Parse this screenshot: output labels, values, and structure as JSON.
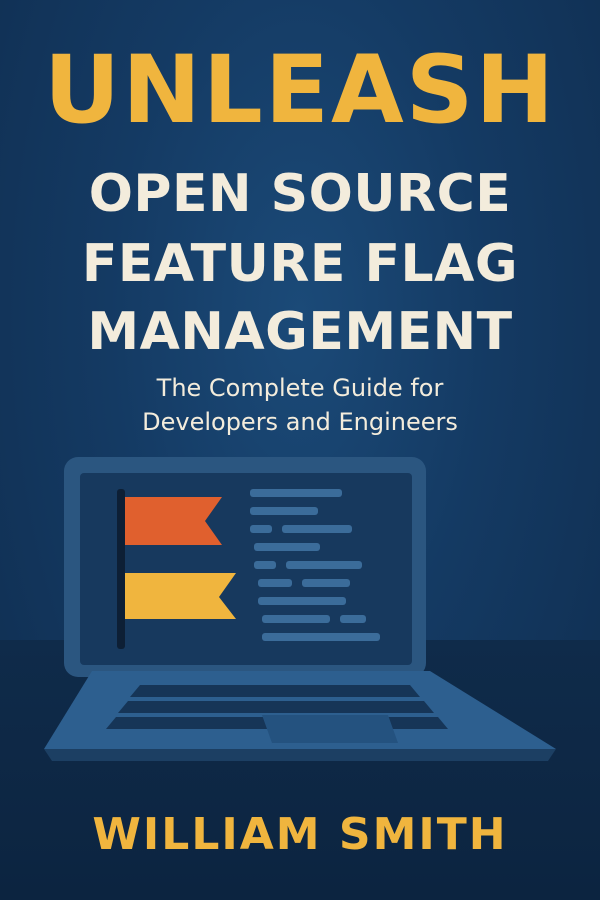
{
  "cover": {
    "title_main": "UNLEASH",
    "title_lines": [
      "OPEN SOURCE",
      "FEATURE FLAG",
      "MANAGEMENT"
    ],
    "subtitle_lines": [
      "The Complete Guide for",
      "Developers and Engineers"
    ],
    "author": "WILLIAM SMITH"
  },
  "colors": {
    "background": "#143a63",
    "accent_gold": "#f0b53e",
    "text_cream": "#f3ecdc",
    "flag_orange": "#e0602e",
    "flag_yellow": "#f0b53e",
    "screen_dark": "#17395e",
    "laptop_body": "#2d5f8f"
  },
  "illustration": {
    "subject": "laptop-icon",
    "screen_icon": "flag-icon"
  }
}
